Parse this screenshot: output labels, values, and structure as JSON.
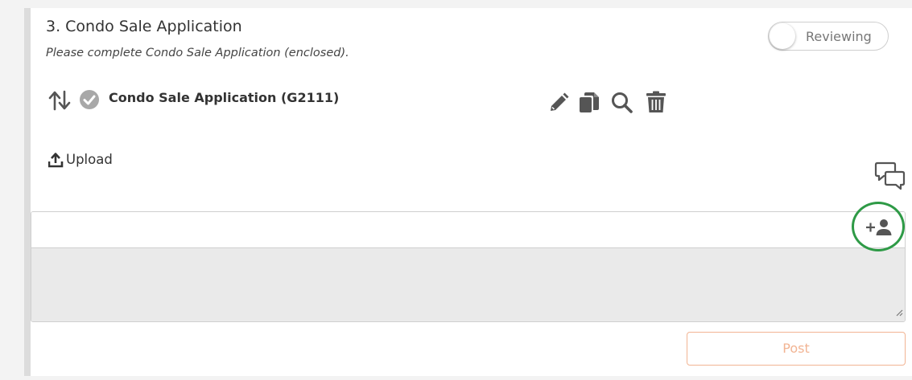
{
  "step": {
    "title": "3. Condo Sale Application",
    "subtitle": "Please complete Condo Sale Application (enclosed)."
  },
  "toggle": {
    "label": "Reviewing",
    "on": false
  },
  "document": {
    "name": "Condo Sale Application (G2111)",
    "status": "completed",
    "actions": [
      "pencil-icon",
      "copy-icon",
      "search-icon",
      "trash-icon"
    ]
  },
  "upload": {
    "label": "Upload"
  },
  "comment": {
    "input_value": "",
    "textarea_value": ""
  },
  "post": {
    "label": "Post"
  },
  "colors": {
    "post_accent": "#f2b493",
    "highlight": "#2e9a46",
    "icon": "#555555"
  }
}
